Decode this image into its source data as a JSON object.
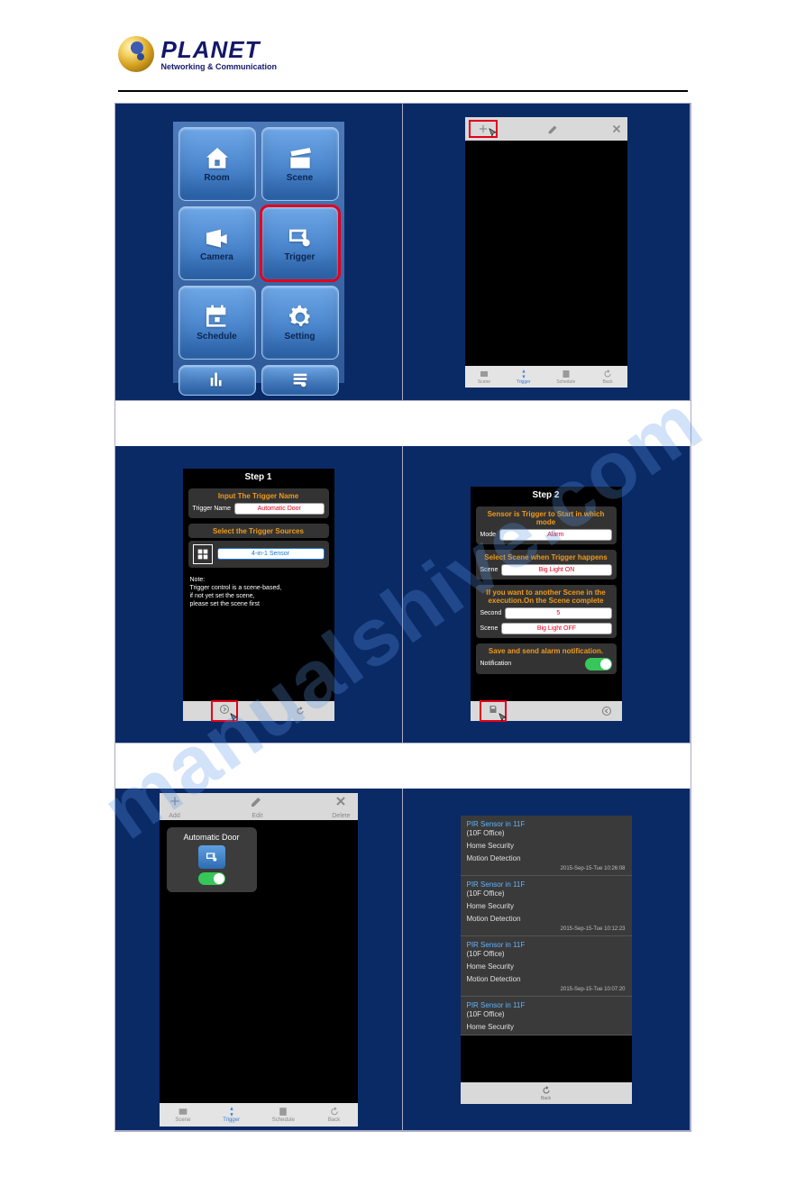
{
  "header": {
    "brand": "PLANET",
    "tagline": "Networking & Communication"
  },
  "watermark": "manualshive.com",
  "cell1": {
    "tiles": [
      {
        "label": "Room",
        "icon": "home-icon"
      },
      {
        "label": "Scene",
        "icon": "clapper-icon"
      },
      {
        "label": "Camera",
        "icon": "camera-icon"
      },
      {
        "label": "Trigger",
        "icon": "trigger-icon",
        "highlight": true
      },
      {
        "label": "Schedule",
        "icon": "calendar-icon"
      },
      {
        "label": "Setting",
        "icon": "gear-icon"
      }
    ]
  },
  "cell2": {
    "topbar": {
      "add": "Add",
      "edit": "Edit",
      "delete": "Delete"
    },
    "botbar": [
      "Scene",
      "Trigger",
      "Schedule",
      "Back"
    ]
  },
  "cell3": {
    "step_title": "Step 1",
    "panel1_title": "Input The Trigger Name",
    "trigger_name_label": "Trigger Name",
    "trigger_name_value": "Automatic Door",
    "panel2_title": "Select the Trigger Sources",
    "source_value": "4-in-1 Sensor",
    "note_head": "Note:",
    "note_l1": "Trigger control is a scene-based,",
    "note_l2": "if not yet set the scene,",
    "note_l3": "please set the scene first"
  },
  "cell4": {
    "step_title": "Step 2",
    "p1_title": "Sensor is Trigger to Start in which mode",
    "mode_label": "Mode",
    "mode_value": "Alarm",
    "p2_title": "Select Scene when Trigger happens",
    "scene1_label": "Scene",
    "scene1_value": "Big Light ON",
    "p3_title": "If you want to another Scene in the execution.On the Scene complete",
    "second_label": "Second",
    "second_value": "5",
    "scene2_label": "Scene",
    "scene2_value": "Big Light OFF",
    "p4_title": "Save and send alarm notification.",
    "notif_label": "Notification"
  },
  "cell5": {
    "topbar": {
      "add": "Add",
      "edit": "Edit",
      "delete": "Delete"
    },
    "card_name": "Automatic Door",
    "botbar": [
      "Scene",
      "Trigger",
      "Schedule",
      "Back"
    ]
  },
  "cell6": {
    "items": [
      {
        "title": "PIR Sensor in 11F",
        "loc": "(10F Office)",
        "l1": "Home Security",
        "l2": "Motion Detection",
        "ts": "2015-Sep-15-Tue  10:26:08"
      },
      {
        "title": "PIR Sensor in 11F",
        "loc": "(10F Office)",
        "l1": "Home Security",
        "l2": "Motion Detection",
        "ts": "2015-Sep-15-Tue  10:12:23"
      },
      {
        "title": "PIR Sensor in 11F",
        "loc": "(10F Office)",
        "l1": "Home Security",
        "l2": "Motion Detection",
        "ts": "2015-Sep-15-Tue  10:07:20"
      },
      {
        "title": "PIR Sensor in 11F",
        "loc": "(10F Office)",
        "l1": "Home Security",
        "l2": "",
        "ts": ""
      }
    ],
    "back_label": "Back"
  }
}
